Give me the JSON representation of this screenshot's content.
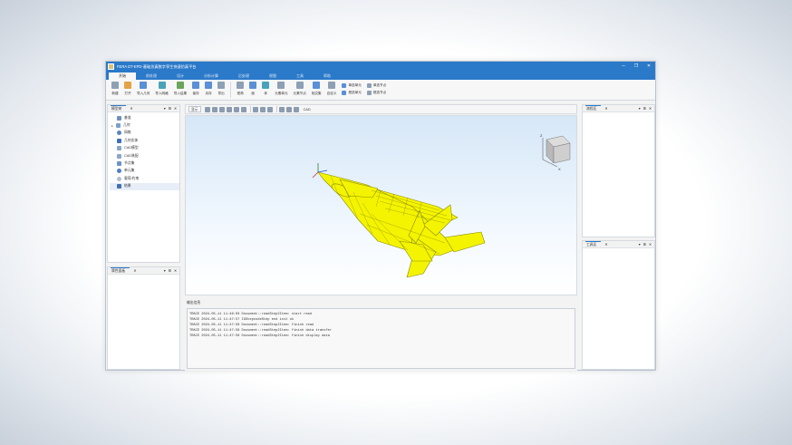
{
  "window": {
    "title": "FERA DT-EPD-基础仿真数字孪生快速仿真平台",
    "buttons": [
      "─",
      "❐",
      "✕"
    ]
  },
  "tabs": [
    {
      "label": "开始",
      "active": true
    },
    {
      "label": "前处理",
      "active": false
    },
    {
      "label": "设计",
      "active": false
    },
    {
      "label": "分析计算",
      "active": false
    },
    {
      "label": "后处理",
      "active": false
    },
    {
      "label": "视图",
      "active": false
    },
    {
      "label": "工具",
      "active": false
    },
    {
      "label": "帮助",
      "active": false
    }
  ],
  "ribbon": {
    "buttons": [
      {
        "label": "新建",
        "icon": "new-file-icon"
      },
      {
        "label": "打开",
        "icon": "open-folder-icon"
      },
      {
        "label": "导入几何",
        "icon": "import-geometry-icon"
      },
      {
        "label": "导入网格",
        "icon": "import-mesh-icon"
      },
      {
        "label": "导入结果",
        "icon": "import-result-icon"
      },
      {
        "label": "保存",
        "icon": "save-icon"
      },
      {
        "label": "另存",
        "icon": "save-as-icon"
      },
      {
        "label": "导出",
        "icon": "export-icon"
      },
      {
        "label": "视角",
        "icon": "view-angle-icon"
      },
      {
        "label": "面",
        "icon": "face-icon"
      },
      {
        "label": "体",
        "icon": "solid-icon"
      },
      {
        "label": "元素单元",
        "icon": "element-icon"
      },
      {
        "label": "元素节点",
        "icon": "node-icon"
      },
      {
        "label": "相交集",
        "icon": "intersect-icon"
      },
      {
        "label": "自定义",
        "icon": "custom-icon"
      }
    ],
    "small": [
      {
        "label": "单选单元",
        "icon": "single-element-icon"
      },
      {
        "label": "框选单元",
        "icon": "box-element-icon"
      },
      {
        "label": "单选节点",
        "icon": "single-node-icon"
      },
      {
        "label": "框选节点",
        "icon": "box-node-icon"
      }
    ]
  },
  "model_panel": {
    "title": "模型树",
    "items": [
      {
        "label": "基准",
        "icon": "datum-icon",
        "color": "#6e8fb8",
        "expandable": false
      },
      {
        "label": "几何",
        "icon": "geometry-icon",
        "color": "#7aa0cc",
        "expandable": true
      },
      {
        "label": "网格",
        "icon": "mesh-icon",
        "color": "#5b85c2",
        "expandable": false
      },
      {
        "label": "几何实体",
        "icon": "solid-body-icon",
        "color": "#3f6fb5",
        "expandable": false
      },
      {
        "label": "CAD模型",
        "icon": "cad-model-icon",
        "color": "#8aa6c8",
        "expandable": false
      },
      {
        "label": "CAD装配",
        "icon": "cad-assembly-icon",
        "color": "#8aa6c8",
        "expandable": false
      },
      {
        "label": "节点集",
        "icon": "node-set-icon",
        "color": "#6b93c7",
        "expandable": false
      },
      {
        "label": "单元集",
        "icon": "element-set-icon",
        "color": "#4e7fc0",
        "expandable": false
      },
      {
        "label": "载荷/约束",
        "icon": "load-icon",
        "color": "#b1bdcc",
        "expandable": false
      },
      {
        "label": "结果",
        "icon": "result-icon",
        "color": "#4570b0",
        "expandable": false,
        "selected": true
      }
    ]
  },
  "property_panel": {
    "title": "属性面板"
  },
  "process_panel": {
    "title": "流程区"
  },
  "tools_panel": {
    "title": "工具区"
  },
  "panel_controls": [
    "▾",
    "⊞",
    "✕"
  ],
  "viewport_toolbar": {
    "display_label": "显示",
    "mode_label": "CAD"
  },
  "cube_axes": {
    "z": "Z",
    "x": "X"
  },
  "output": {
    "title": "输出信息",
    "lines": [
      "TRACE 2024-05-11 11:46:03 Document::readStep2Item: start read",
      "TRACE 2024-05-11 11:47:57 IGStepcodeStep end init ok",
      "TRACE 2024-05-11 11:47:58 Document::readStep2Item: finish read",
      "TRACE 2024-05-11 11:47:58 Document::readStep2Item: finish data transfer",
      "TRACE 2024-05-11 11:47:58 Document::readStep2Item: finish display data"
    ]
  },
  "colors": {
    "accent": "#2b79c9",
    "model": "#f4f400",
    "model_edge": "#8a8a00"
  }
}
